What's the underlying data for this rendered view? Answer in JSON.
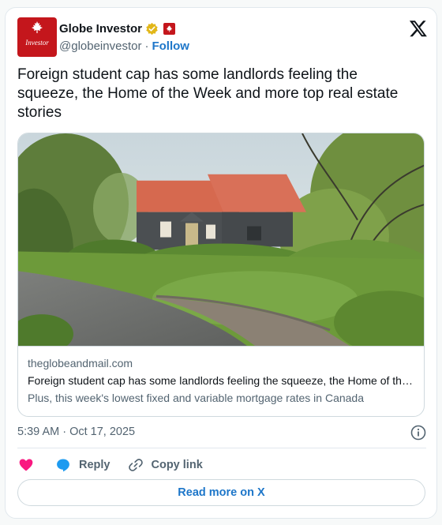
{
  "author": {
    "display_name": "Globe Investor",
    "handle": "@globeinvestor",
    "follow_label": "Follow",
    "avatar_text": "Investor",
    "verified_icon": "gold-verified-badge-icon",
    "affiliate_icon": "maple-leaf-affiliate-icon"
  },
  "post": {
    "text": "Foreign student cap has some landlords feeling the squeeze, the Home of the Week and more top real estate stories",
    "timestamp": "5:39 AM · Oct 17, 2025"
  },
  "link_card": {
    "domain": "theglobeandmail.com",
    "title": "Foreign student cap has some landlords feeling the squeeze, the Home of the Week and more top real estate stories",
    "description": "Plus, this week's lowest fixed and variable mortgage rates in Canada",
    "image_icon": "house-photo"
  },
  "actions": {
    "like_icon": "heart-icon",
    "reply_label": "Reply",
    "copy_label": "Copy link",
    "read_more_label": "Read more on X"
  },
  "colors": {
    "brand_red": "#c4161c",
    "link_blue": "#1d76c9",
    "heart_pink": "#f91880",
    "muted": "#536471"
  }
}
